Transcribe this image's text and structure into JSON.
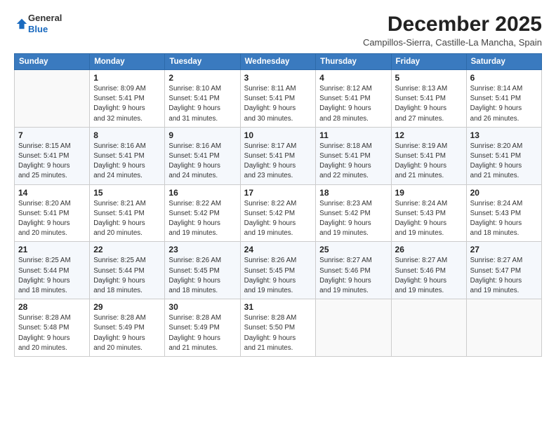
{
  "logo": {
    "line1": "General",
    "line2": "Blue"
  },
  "header": {
    "month_year": "December 2025",
    "location": "Campillos-Sierra, Castille-La Mancha, Spain"
  },
  "days_of_week": [
    "Sunday",
    "Monday",
    "Tuesday",
    "Wednesday",
    "Thursday",
    "Friday",
    "Saturday"
  ],
  "weeks": [
    [
      {
        "day": "",
        "info": ""
      },
      {
        "day": "1",
        "info": "Sunrise: 8:09 AM\nSunset: 5:41 PM\nDaylight: 9 hours\nand 32 minutes."
      },
      {
        "day": "2",
        "info": "Sunrise: 8:10 AM\nSunset: 5:41 PM\nDaylight: 9 hours\nand 31 minutes."
      },
      {
        "day": "3",
        "info": "Sunrise: 8:11 AM\nSunset: 5:41 PM\nDaylight: 9 hours\nand 30 minutes."
      },
      {
        "day": "4",
        "info": "Sunrise: 8:12 AM\nSunset: 5:41 PM\nDaylight: 9 hours\nand 28 minutes."
      },
      {
        "day": "5",
        "info": "Sunrise: 8:13 AM\nSunset: 5:41 PM\nDaylight: 9 hours\nand 27 minutes."
      },
      {
        "day": "6",
        "info": "Sunrise: 8:14 AM\nSunset: 5:41 PM\nDaylight: 9 hours\nand 26 minutes."
      }
    ],
    [
      {
        "day": "7",
        "info": "Sunrise: 8:15 AM\nSunset: 5:41 PM\nDaylight: 9 hours\nand 25 minutes."
      },
      {
        "day": "8",
        "info": "Sunrise: 8:16 AM\nSunset: 5:41 PM\nDaylight: 9 hours\nand 24 minutes."
      },
      {
        "day": "9",
        "info": "Sunrise: 8:16 AM\nSunset: 5:41 PM\nDaylight: 9 hours\nand 24 minutes."
      },
      {
        "day": "10",
        "info": "Sunrise: 8:17 AM\nSunset: 5:41 PM\nDaylight: 9 hours\nand 23 minutes."
      },
      {
        "day": "11",
        "info": "Sunrise: 8:18 AM\nSunset: 5:41 PM\nDaylight: 9 hours\nand 22 minutes."
      },
      {
        "day": "12",
        "info": "Sunrise: 8:19 AM\nSunset: 5:41 PM\nDaylight: 9 hours\nand 21 minutes."
      },
      {
        "day": "13",
        "info": "Sunrise: 8:20 AM\nSunset: 5:41 PM\nDaylight: 9 hours\nand 21 minutes."
      }
    ],
    [
      {
        "day": "14",
        "info": "Sunrise: 8:20 AM\nSunset: 5:41 PM\nDaylight: 9 hours\nand 20 minutes."
      },
      {
        "day": "15",
        "info": "Sunrise: 8:21 AM\nSunset: 5:41 PM\nDaylight: 9 hours\nand 20 minutes."
      },
      {
        "day": "16",
        "info": "Sunrise: 8:22 AM\nSunset: 5:42 PM\nDaylight: 9 hours\nand 19 minutes."
      },
      {
        "day": "17",
        "info": "Sunrise: 8:22 AM\nSunset: 5:42 PM\nDaylight: 9 hours\nand 19 minutes."
      },
      {
        "day": "18",
        "info": "Sunrise: 8:23 AM\nSunset: 5:42 PM\nDaylight: 9 hours\nand 19 minutes."
      },
      {
        "day": "19",
        "info": "Sunrise: 8:24 AM\nSunset: 5:43 PM\nDaylight: 9 hours\nand 19 minutes."
      },
      {
        "day": "20",
        "info": "Sunrise: 8:24 AM\nSunset: 5:43 PM\nDaylight: 9 hours\nand 18 minutes."
      }
    ],
    [
      {
        "day": "21",
        "info": "Sunrise: 8:25 AM\nSunset: 5:44 PM\nDaylight: 9 hours\nand 18 minutes."
      },
      {
        "day": "22",
        "info": "Sunrise: 8:25 AM\nSunset: 5:44 PM\nDaylight: 9 hours\nand 18 minutes."
      },
      {
        "day": "23",
        "info": "Sunrise: 8:26 AM\nSunset: 5:45 PM\nDaylight: 9 hours\nand 18 minutes."
      },
      {
        "day": "24",
        "info": "Sunrise: 8:26 AM\nSunset: 5:45 PM\nDaylight: 9 hours\nand 19 minutes."
      },
      {
        "day": "25",
        "info": "Sunrise: 8:27 AM\nSunset: 5:46 PM\nDaylight: 9 hours\nand 19 minutes."
      },
      {
        "day": "26",
        "info": "Sunrise: 8:27 AM\nSunset: 5:46 PM\nDaylight: 9 hours\nand 19 minutes."
      },
      {
        "day": "27",
        "info": "Sunrise: 8:27 AM\nSunset: 5:47 PM\nDaylight: 9 hours\nand 19 minutes."
      }
    ],
    [
      {
        "day": "28",
        "info": "Sunrise: 8:28 AM\nSunset: 5:48 PM\nDaylight: 9 hours\nand 20 minutes."
      },
      {
        "day": "29",
        "info": "Sunrise: 8:28 AM\nSunset: 5:49 PM\nDaylight: 9 hours\nand 20 minutes."
      },
      {
        "day": "30",
        "info": "Sunrise: 8:28 AM\nSunset: 5:49 PM\nDaylight: 9 hours\nand 21 minutes."
      },
      {
        "day": "31",
        "info": "Sunrise: 8:28 AM\nSunset: 5:50 PM\nDaylight: 9 hours\nand 21 minutes."
      },
      {
        "day": "",
        "info": ""
      },
      {
        "day": "",
        "info": ""
      },
      {
        "day": "",
        "info": ""
      }
    ]
  ]
}
